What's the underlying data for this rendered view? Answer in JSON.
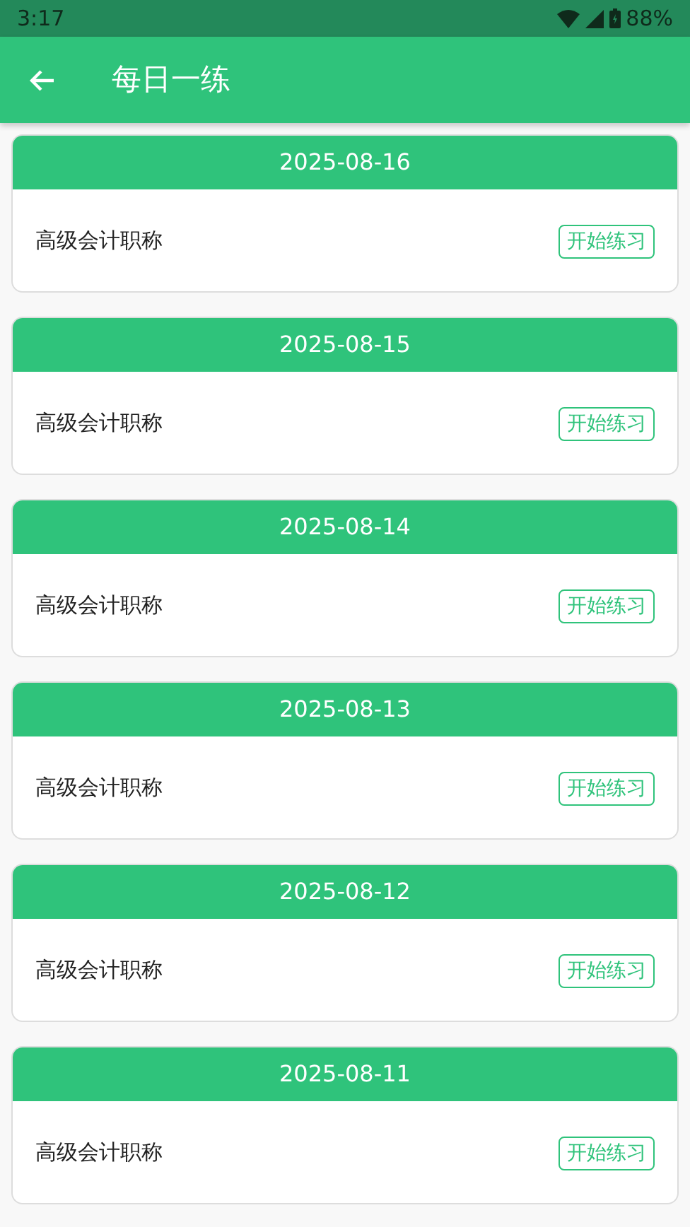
{
  "status_bar": {
    "time": "3:17",
    "battery": "88%"
  },
  "app_bar": {
    "title": "每日一练"
  },
  "cards": [
    {
      "date": "2025-08-16",
      "title": "高级会计职称",
      "action": "开始练习"
    },
    {
      "date": "2025-08-15",
      "title": "高级会计职称",
      "action": "开始练习"
    },
    {
      "date": "2025-08-14",
      "title": "高级会计职称",
      "action": "开始练习"
    },
    {
      "date": "2025-08-13",
      "title": "高级会计职称",
      "action": "开始练习"
    },
    {
      "date": "2025-08-12",
      "title": "高级会计职称",
      "action": "开始练习"
    },
    {
      "date": "2025-08-11",
      "title": "高级会计职称",
      "action": "开始练习"
    }
  ]
}
